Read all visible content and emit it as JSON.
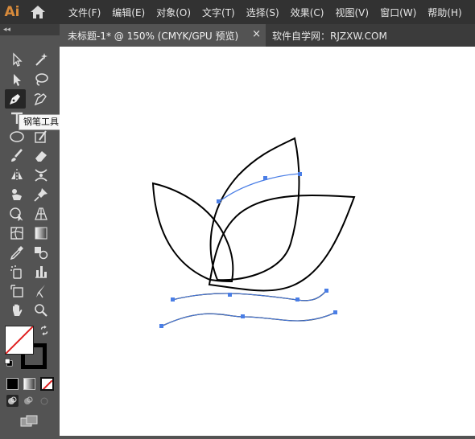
{
  "app": {
    "logo": "Ai",
    "home_icon": "home-icon"
  },
  "menu": [
    {
      "label": "文件(F)"
    },
    {
      "label": "编辑(E)"
    },
    {
      "label": "对象(O)"
    },
    {
      "label": "文字(T)"
    },
    {
      "label": "选择(S)"
    },
    {
      "label": "效果(C)"
    },
    {
      "label": "视图(V)"
    },
    {
      "label": "窗口(W)"
    },
    {
      "label": "帮助(H)"
    }
  ],
  "tabs": {
    "active_label": "未标题-1* @ 150% (CMYK/GPU 预览)",
    "close": "×",
    "other_label": "软件自学网：RJZXW.COM"
  },
  "toolbar": {
    "collapse": "◂◂"
  },
  "tooltip": {
    "text": "钢笔工具 (P)"
  },
  "colors": {
    "selection_blue": "#4a7ee6",
    "path_black": "#000000",
    "menubar_bg": "#323232",
    "panel_bg": "#535353",
    "logo": "#d78a3b"
  }
}
